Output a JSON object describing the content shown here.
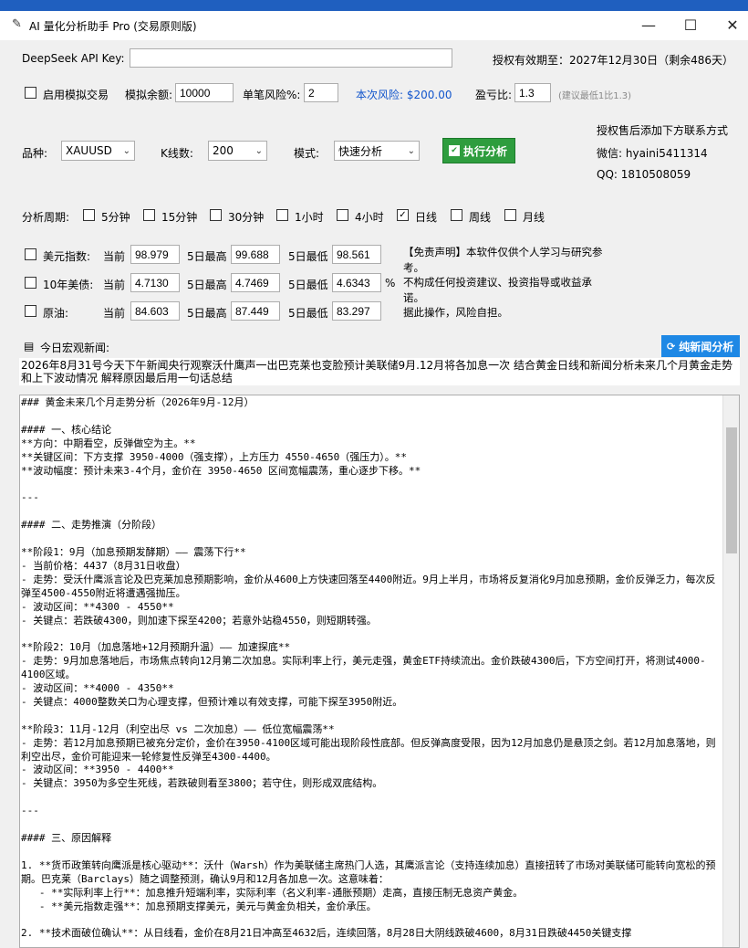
{
  "window": {
    "title": "AI 量化分析助手 Pro (交易原则版)",
    "controls": [
      "—",
      "☐",
      "✕"
    ]
  },
  "api": {
    "label": "DeepSeek API Key:",
    "value": "",
    "license_label": "授权有效期至：2027年12月30日（剩余486天）"
  },
  "sim": {
    "enable_label": "启用模拟交易",
    "enabled": false,
    "balance_label": "模拟余额:",
    "balance": "10000",
    "risk_label": "单笔风险%:",
    "risk": "2",
    "risk_amount": "本次风险: $200.00",
    "rr_label": "盈亏比:",
    "rr": "1.3",
    "rr_hint": "(建议最低1比1.3)"
  },
  "contact": {
    "header": "授权售后添加下方联系方式",
    "wechat": "微信: hyaini5411314",
    "qq": "QQ: 1810508059"
  },
  "symbol": {
    "label": "品种:",
    "value": "XAUUSD",
    "kline_label": "K线数:",
    "kline_value": "200",
    "mode_label": "模式:",
    "mode_value": "快速分析",
    "run_label": "执行分析"
  },
  "periods": {
    "label": "分析周期:",
    "items": [
      {
        "label": "5分钟",
        "checked": false
      },
      {
        "label": "15分钟",
        "checked": false
      },
      {
        "label": "30分钟",
        "checked": false
      },
      {
        "label": "1小时",
        "checked": false
      },
      {
        "label": "4小时",
        "checked": false
      },
      {
        "label": "日线",
        "checked": true
      },
      {
        "label": "周线",
        "checked": false
      },
      {
        "label": "月线",
        "checked": false
      }
    ]
  },
  "indicators": {
    "rows": [
      {
        "name": "美元指数:",
        "current_label": "当前",
        "current": "98.979",
        "high_label": "5日最高",
        "high": "99.688",
        "low_label": "5日最低",
        "low": "98.561",
        "unit": ""
      },
      {
        "name": "10年美债:",
        "current_label": "当前",
        "current": "4.7130",
        "high_label": "5日最高",
        "high": "4.7469",
        "low_label": "5日最低",
        "low": "4.6343",
        "unit": "%"
      },
      {
        "name": "原油:",
        "current_label": "当前",
        "current": "84.603",
        "high_label": "5日最高",
        "high": "87.449",
        "low_label": "5日最低",
        "low": "83.297",
        "unit": ""
      }
    ],
    "disclaimer": "【免责声明】本软件仅供个人学习与研究参考。\n不构成任何投资建议、投资指导或收益承诺。\n据此操作，风险自担。"
  },
  "news": {
    "label": "今日宏观新闻:",
    "button": "纯新闻分析",
    "text": "2026年8月31号今天下午新闻央行观察沃什鹰声一出巴克莱也变脸预计美联储9月.12月将各加息一次 结合黄金日线和新闻分析未来几个月黄金走势和上下波动情况 解释原因最后用一句话总结"
  },
  "output": {
    "text": "### 黄金未来几个月走势分析（2026年9月-12月）\n\n#### 一、核心结论\n**方向：中期看空，反弹做空为主。**\n**关键区间：下方支撑 3950-4000（强支撑），上方压力 4550-4650（强压力）。**\n**波动幅度：预计未来3-4个月，金价在 3950-4650 区间宽幅震荡，重心逐步下移。**\n\n---\n\n#### 二、走势推演（分阶段）\n\n**阶段1：9月（加息预期发酵期）—— 震荡下行**\n- 当前价格：4437（8月31日收盘）\n- 走势：受沃什鹰派言论及巴克莱加息预期影响，金价从4600上方快速回落至4400附近。9月上半月，市场将反复消化9月加息预期，金价反弹乏力，每次反弹至4500-4550附近将遭遇强抛压。\n- 波动区间：**4300 - 4550**\n- 关键点：若跌破4300，则加速下探至4200；若意外站稳4550，则短期转强。\n\n**阶段2：10月（加息落地+12月预期升温）—— 加速探底**\n- 走势：9月加息落地后，市场焦点转向12月第二次加息。实际利率上行，美元走强，黄金ETF持续流出。金价跌破4300后，下方空间打开，将测试4000-4100区域。\n- 波动区间：**4000 - 4350**\n- 关键点：4000整数关口为心理支撑，但预计难以有效支撑，可能下探至3950附近。\n\n**阶段3：11月-12月（利空出尽 vs 二次加息）—— 低位宽幅震荡**\n- 走势：若12月加息预期已被充分定价，金价在3950-4100区域可能出现阶段性底部。但反弹高度受限，因为12月加息仍是悬顶之剑。若12月加息落地，则利空出尽，金价可能迎来一轮修复性反弹至4300-4400。\n- 波动区间：**3950 - 4400**\n- 关键点：3950为多空生死线，若跌破则看至3800；若守住，则形成双底结构。\n\n---\n\n#### 三、原因解释\n\n1. **货币政策转向鹰派是核心驱动**：沃什（Warsh）作为美联储主席热门人选，其鹰派言论（支持连续加息）直接扭转了市场对美联储可能转向宽松的预期。巴克莱（Barclays）随之调整预测，确认9月和12月各加息一次。这意味着：\n   - **实际利率上行**：加息推升短端利率，实际利率（名义利率-通胀预期）走高，直接压制无息资产黄金。\n   - **美元指数走强**：加息预期支撑美元，美元与黄金负相关，金价承压。\n\n2. **技术面破位确认**：从日线看，金价在8月21日冲高至4632后，连续回落，8月28日大阴线跌破4600，8月31日跌破4450关键支撑"
  }
}
